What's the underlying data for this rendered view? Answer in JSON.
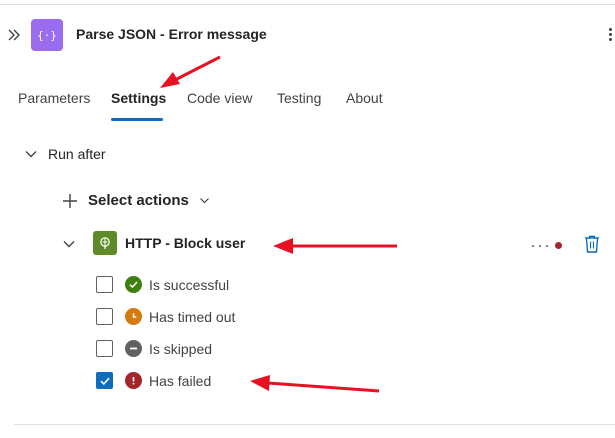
{
  "header": {
    "title": "Parse JSON - Error message",
    "icon": "braces-icon",
    "accent_color": "#9b6cf0"
  },
  "tabs": [
    {
      "label": "Parameters",
      "active": false
    },
    {
      "label": "Settings",
      "active": true
    },
    {
      "label": "Code view",
      "active": false
    },
    {
      "label": "Testing",
      "active": false
    },
    {
      "label": "About",
      "active": false
    }
  ],
  "run_after": {
    "section_label": "Run after",
    "select_actions_label": "Select actions",
    "action": {
      "title": "HTTP - Block user",
      "icon": "globe-icon",
      "icon_color": "#5e8a28"
    },
    "options": [
      {
        "label": "Is successful",
        "checked": false,
        "icon": "check-circle-icon",
        "color": "#3f7f0e"
      },
      {
        "label": "Has timed out",
        "checked": false,
        "icon": "clock-icon",
        "color": "#d67a0f"
      },
      {
        "label": "Is skipped",
        "checked": false,
        "icon": "minus-circle-icon",
        "color": "#616161"
      },
      {
        "label": "Has failed",
        "checked": true,
        "icon": "exclamation-circle-icon",
        "color": "#a4262c"
      }
    ]
  },
  "colors": {
    "tab_underline": "#0f6cbd",
    "checkbox_checked": "#0f6cbd",
    "annotation_arrow": "#e81123"
  }
}
